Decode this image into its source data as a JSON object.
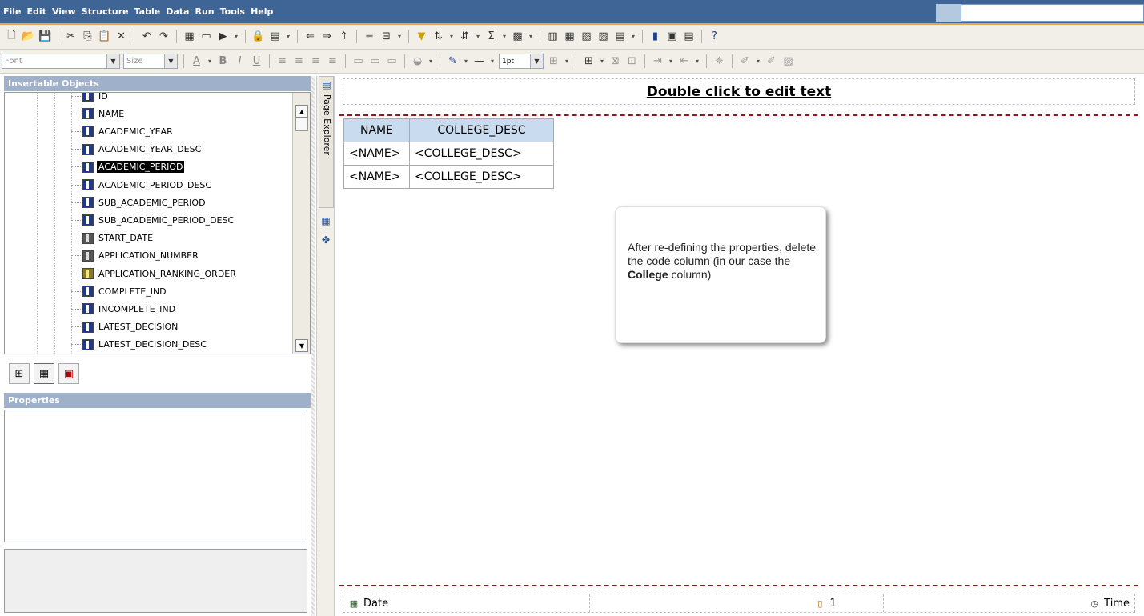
{
  "menu": {
    "items": [
      "File",
      "Edit",
      "View",
      "Structure",
      "Table",
      "Data",
      "Run",
      "Tools",
      "Help"
    ]
  },
  "toolbar2": {
    "font_placeholder": "Font",
    "size_placeholder": "Size",
    "line_width": "1pt"
  },
  "insertable": {
    "header": "Insertable Objects",
    "items": [
      {
        "label": "ID",
        "type": "text"
      },
      {
        "label": "NAME",
        "type": "text"
      },
      {
        "label": "ACADEMIC_YEAR",
        "type": "text"
      },
      {
        "label": "ACADEMIC_YEAR_DESC",
        "type": "text"
      },
      {
        "label": "ACADEMIC_PERIOD",
        "type": "text",
        "selected": true
      },
      {
        "label": "ACADEMIC_PERIOD_DESC",
        "type": "text"
      },
      {
        "label": "SUB_ACADEMIC_PERIOD",
        "type": "text"
      },
      {
        "label": "SUB_ACADEMIC_PERIOD_DESC",
        "type": "text"
      },
      {
        "label": "START_DATE",
        "type": "date"
      },
      {
        "label": "APPLICATION_NUMBER",
        "type": "date"
      },
      {
        "label": "APPLICATION_RANKING_ORDER",
        "type": "number"
      },
      {
        "label": "COMPLETE_IND",
        "type": "text"
      },
      {
        "label": "INCOMPLETE_IND",
        "type": "text"
      },
      {
        "label": "LATEST_DECISION",
        "type": "text"
      },
      {
        "label": "LATEST_DECISION_DESC",
        "type": "text"
      }
    ]
  },
  "properties": {
    "header": "Properties"
  },
  "explorer": {
    "page_explorer_label": "Page Explorer"
  },
  "canvas": {
    "title": "Double click to edit text",
    "table": {
      "headers": [
        "NAME",
        "COLLEGE_DESC"
      ],
      "rows": [
        [
          "<NAME>",
          "<COLLEGE_DESC>"
        ],
        [
          "<NAME>",
          "<COLLEGE_DESC>"
        ]
      ]
    },
    "callout": {
      "text_before": "After re-defining the properties, delete the code column (in our case the",
      "text_bold": "College",
      "text_after": "column)"
    },
    "footer": {
      "date_label": "Date",
      "page_number": "1",
      "time_label": "Time"
    }
  }
}
